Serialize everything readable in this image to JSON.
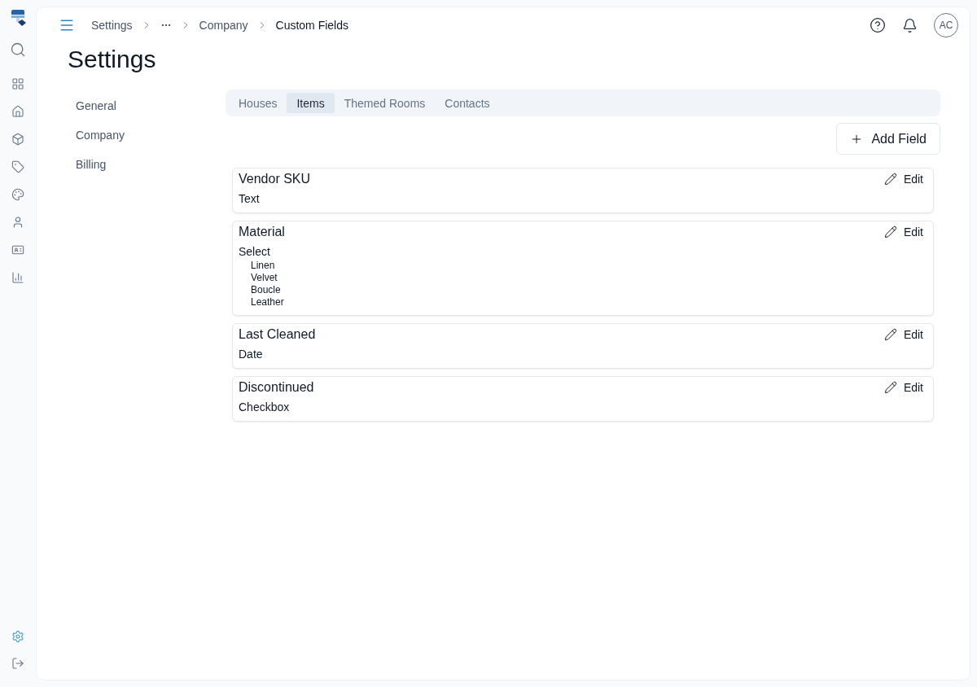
{
  "rail": {
    "items": [
      {
        "selected": false
      },
      {
        "selected": false
      },
      {
        "selected": false
      },
      {
        "selected": false
      },
      {
        "selected": false
      },
      {
        "selected": false
      },
      {
        "selected": false
      },
      {
        "selected": false
      },
      {
        "selected": false
      }
    ],
    "footer_items": [
      {
        "selected": true
      },
      {
        "selected": false
      }
    ]
  },
  "header": {
    "breadcrumb": [
      {
        "kind": "link",
        "label": "Settings"
      },
      {
        "kind": "ellipsis"
      },
      {
        "kind": "link",
        "label": "Company"
      },
      {
        "kind": "current",
        "label": "Custom Fields"
      }
    ],
    "avatar": {
      "initials": "AC"
    }
  },
  "page_title": "Settings",
  "settings_nav": {
    "items": [
      {
        "label": "General"
      },
      {
        "label": "Company"
      },
      {
        "label": "Billing"
      }
    ]
  },
  "tabs": [
    {
      "label": "Houses",
      "selected": false
    },
    {
      "label": "Items",
      "selected": true
    },
    {
      "label": "Themed Rooms",
      "selected": false
    },
    {
      "label": "Contacts",
      "selected": false
    }
  ],
  "add_button": {
    "label": "Add Field"
  },
  "fields": [
    {
      "name": "Vendor SKU",
      "type": "Text",
      "edit_label": "Edit"
    },
    {
      "name": "Material",
      "type": "Select",
      "options": [
        "Linen",
        "Velvet",
        "Boucle",
        "Leather"
      ],
      "edit_label": "Edit"
    },
    {
      "name": "Last Cleaned",
      "type": "Date",
      "edit_label": "Edit"
    },
    {
      "name": "Discontinued",
      "type": "Checkbox",
      "edit_label": "Edit"
    }
  ]
}
